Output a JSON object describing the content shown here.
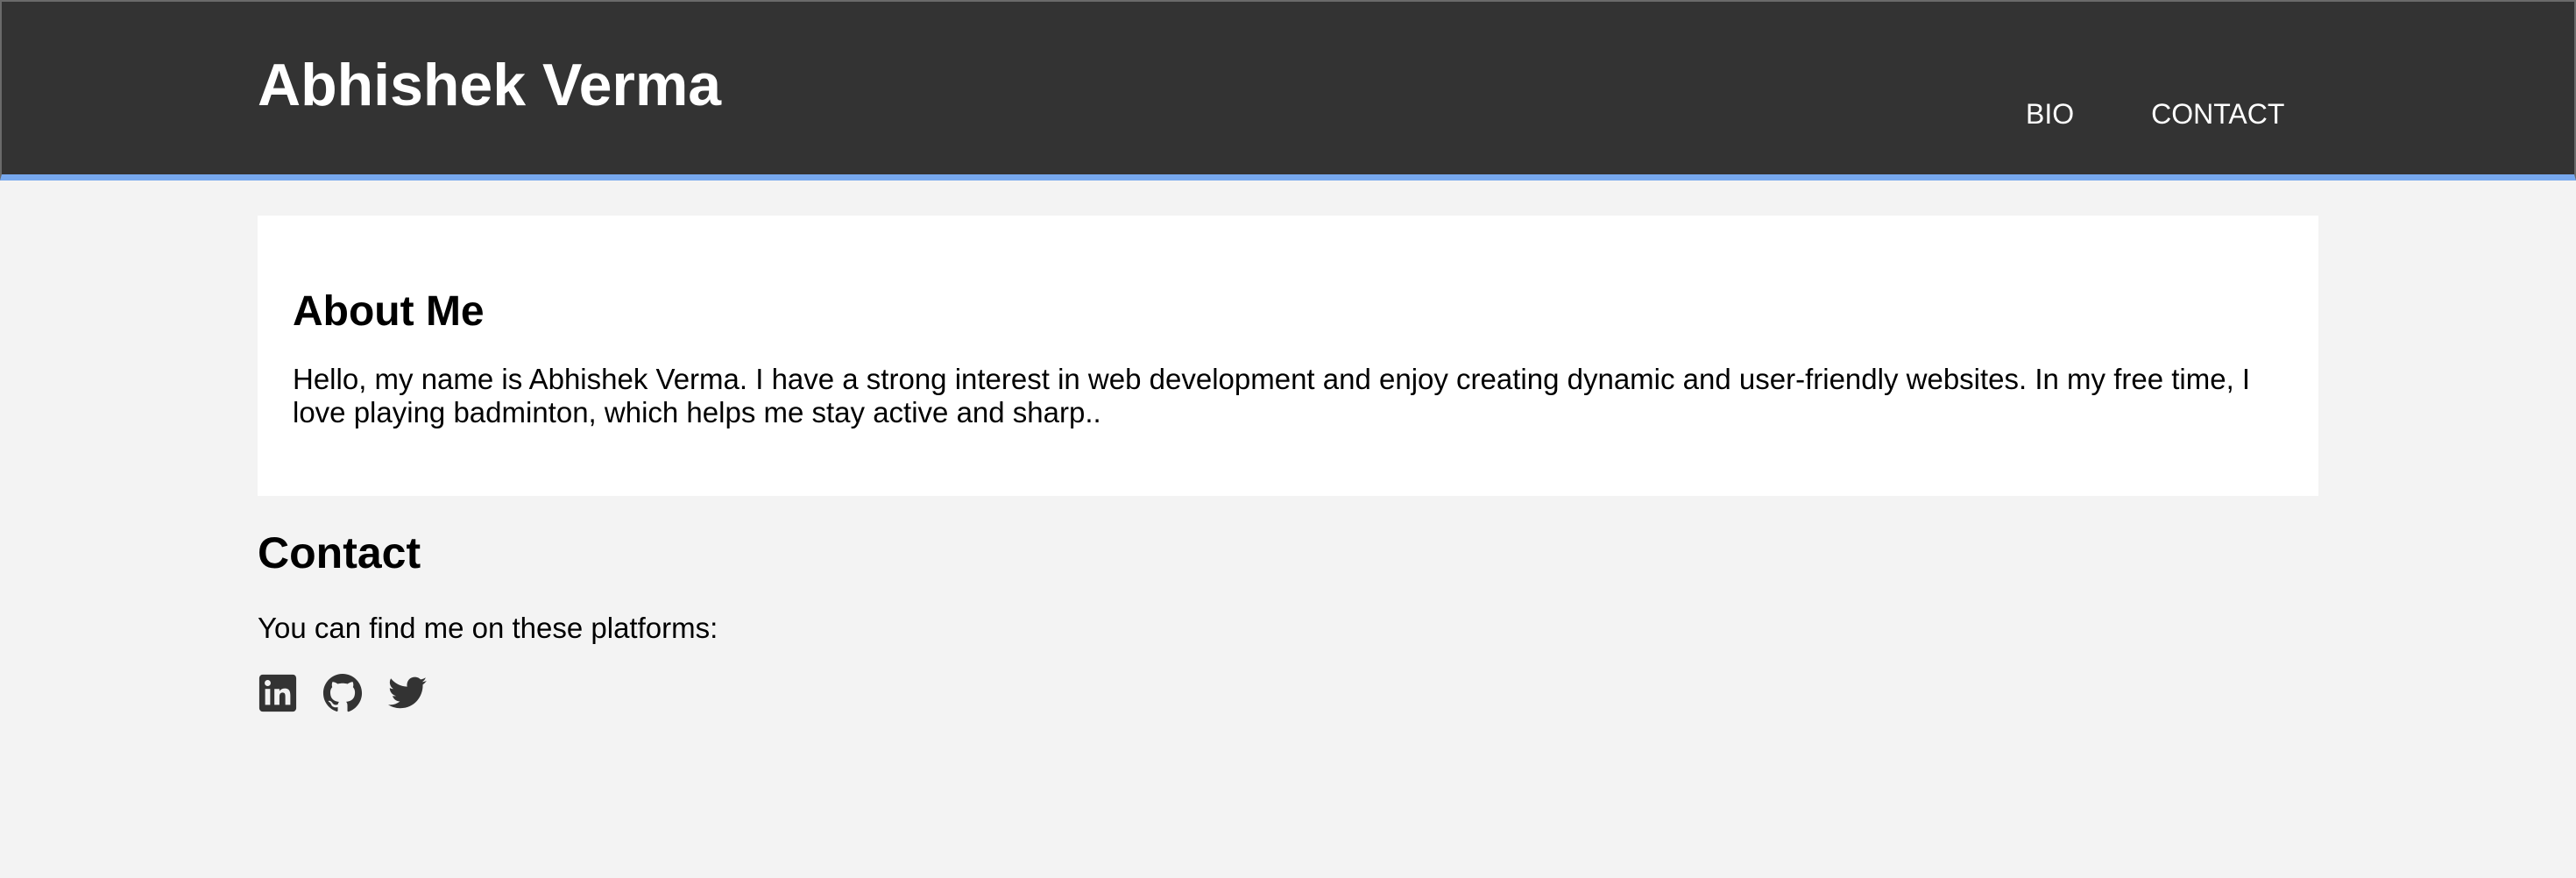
{
  "header": {
    "title": "Abhishek Verma",
    "nav": [
      {
        "label": "BIO"
      },
      {
        "label": "CONTACT"
      }
    ]
  },
  "about": {
    "heading": "About Me",
    "text": "Hello, my name is Abhishek Verma. I have a strong interest in web development and enjoy creating dynamic and user-friendly websites. In my free time, I love playing badminton, which helps me stay active and sharp.."
  },
  "contact": {
    "heading": "Contact",
    "text": "You can find me on these platforms:",
    "icons": [
      "linkedin-icon",
      "github-icon",
      "twitter-icon"
    ]
  },
  "colors": {
    "header_bg": "#333333",
    "header_accent": "#77a8ee",
    "page_bg": "#f3f3f3",
    "card_bg": "#ffffff",
    "icon_color": "#333333"
  }
}
